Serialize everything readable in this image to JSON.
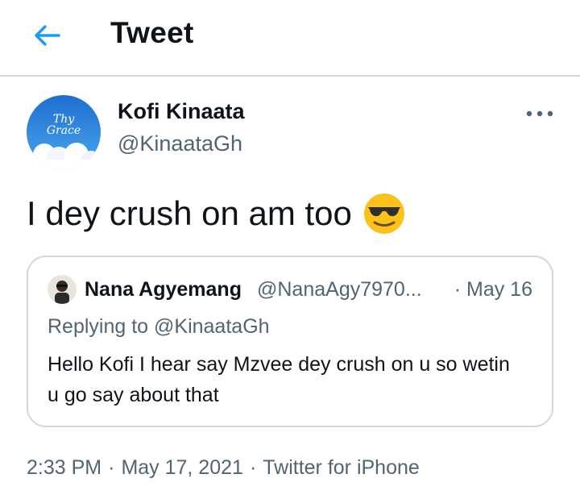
{
  "header": {
    "title": "Tweet",
    "back_icon": "arrow-left-icon",
    "accent_color": "#1d9bf0"
  },
  "tweet": {
    "author_name": "Kofi Kinaata",
    "author_handle": "@KinaataGh",
    "avatar_text_line1": "Thy",
    "avatar_text_line2": "Grace",
    "text": "I dey crush on am too",
    "emoji": "smiling-face-with-sunglasses",
    "time": "2:33 PM",
    "date": "May 17, 2021",
    "source": "Twitter for iPhone",
    "separator": "·"
  },
  "quoted_tweet": {
    "author_name": "Nana Agyemang",
    "author_handle": "@NanaAgy7970...",
    "date": "· May 16",
    "replying_to": "Replying to @KinaataGh",
    "text": "Hello Kofi I hear say Mzvee dey crush on u so wetin u go say about that"
  },
  "colors": {
    "text_primary": "#0f1419",
    "text_secondary": "#536471",
    "border": "#cfd9de"
  }
}
